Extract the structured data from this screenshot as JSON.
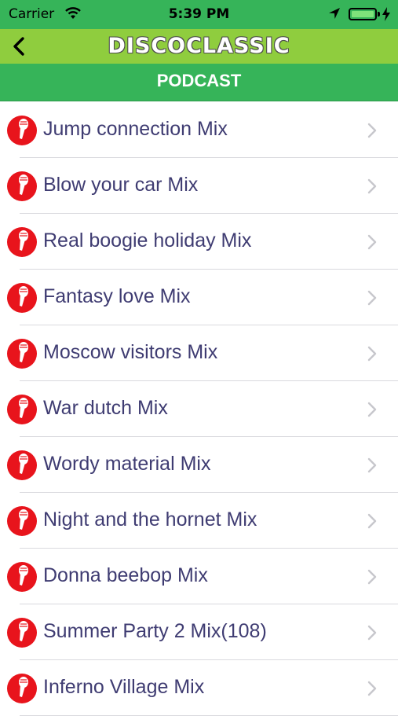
{
  "status_bar": {
    "carrier": "Carrier",
    "time": "5:39 PM",
    "icons": [
      "wifi-icon",
      "location-arrow-icon",
      "battery-icon",
      "charging-bolt-icon"
    ]
  },
  "nav": {
    "title": "DISCOCLASSIC",
    "back_icon": "chevron-left-icon"
  },
  "section": {
    "title": "PODCAST"
  },
  "colors": {
    "status_bg": "#36b459",
    "nav_bg": "#8fcd3e",
    "item_text": "#3f3c72",
    "mic_badge": "#e8141c"
  },
  "podcasts": [
    {
      "title": "Jump connection Mix"
    },
    {
      "title": "Blow your car Mix"
    },
    {
      "title": "Real boogie holiday Mix"
    },
    {
      "title": "Fantasy love Mix"
    },
    {
      "title": "Moscow visitors Mix"
    },
    {
      "title": "War dutch Mix"
    },
    {
      "title": "Wordy material Mix"
    },
    {
      "title": "Night and the hornet Mix"
    },
    {
      "title": "Donna beebop Mix"
    },
    {
      "title": "Summer Party 2 Mix(108)"
    },
    {
      "title": "Inferno Village Mix"
    }
  ]
}
